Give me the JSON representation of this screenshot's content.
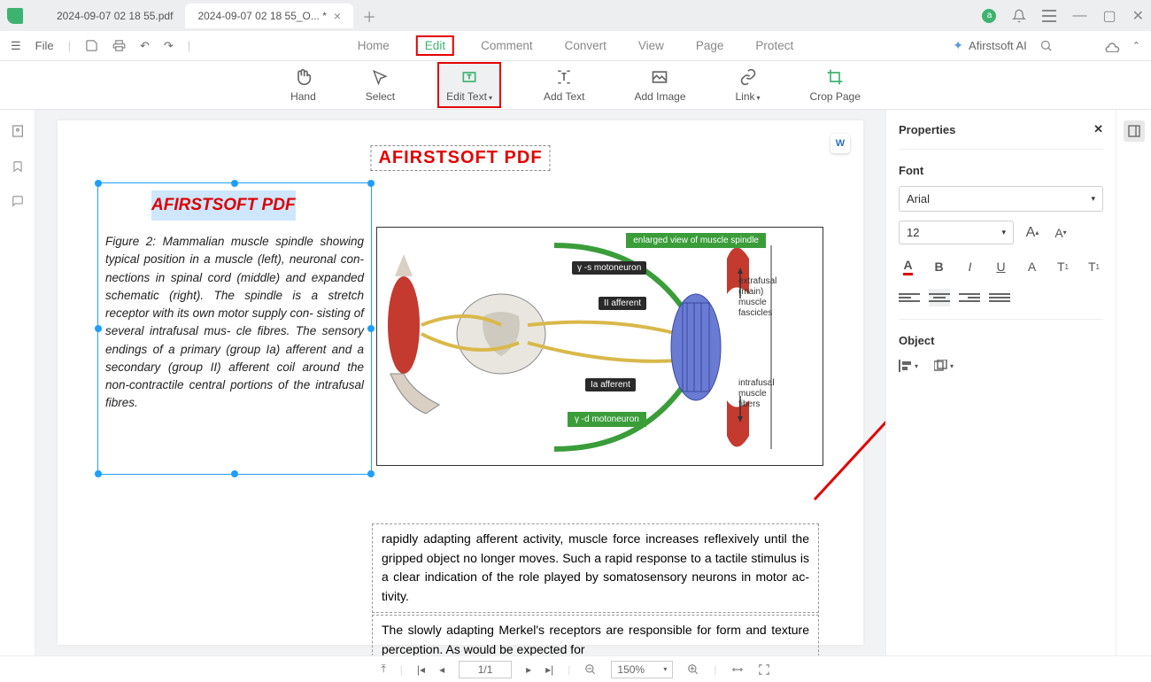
{
  "titlebar": {
    "tab1": "2024-09-07 02 18 55.pdf",
    "tab2": "2024-09-07 02 18 55_O... *"
  },
  "menu": {
    "file": "File",
    "items": [
      "Home",
      "Edit",
      "Comment",
      "Convert",
      "View",
      "Page",
      "Protect"
    ],
    "ai": "Afirstsoft AI"
  },
  "toolbar": {
    "hand": "Hand",
    "select": "Select",
    "edit_text": "Edit Text",
    "add_text": "Add Text",
    "add_image": "Add Image",
    "link": "Link",
    "crop": "Crop Page"
  },
  "doc": {
    "title_red": "AFIRSTSOFT PDF",
    "sel_title": "AFIRSTSOFT PDF",
    "sel_body": "Figure 2: Mammalian muscle spindle showing typical position in a muscle (left), neuronal con- nections in spinal cord (middle) and expanded schematic (right). The spindle is a stretch receptor with its own motor supply con- sisting of several intrafusal mus- cle fibres. The sensory endings of a primary (group Ia) afferent and a secondary (group II) afferent coil around the non-contractile central portions of the intrafusal fibres.",
    "fig": {
      "enlarged": "enlarged view of muscle spindle",
      "gamma_s": "γ -s motoneuron",
      "ii_aff": "II afferent",
      "ia_aff": "Ia afferent",
      "gamma_d": "γ -d motoneuron",
      "extrafusal": "extrafusal (main) muscle fascicles",
      "intrafusal": "intrafusal muscle fibers"
    },
    "lower1": "rapidly adapting afferent activity, muscle force increases reflexively until the gripped object no longer moves. Such a rapid response to a tactile stimulus is a clear indication of the role played by somatosensory neurons in motor ac- tivity.",
    "lower2": "The slowly adapting Merkel's receptors are responsible for form and texture perception. As would be expected for"
  },
  "props": {
    "title": "Properties",
    "font": "Font",
    "font_family": "Arial",
    "font_size": "12",
    "object": "Object"
  },
  "status": {
    "page": "1/1",
    "zoom": "150%"
  }
}
